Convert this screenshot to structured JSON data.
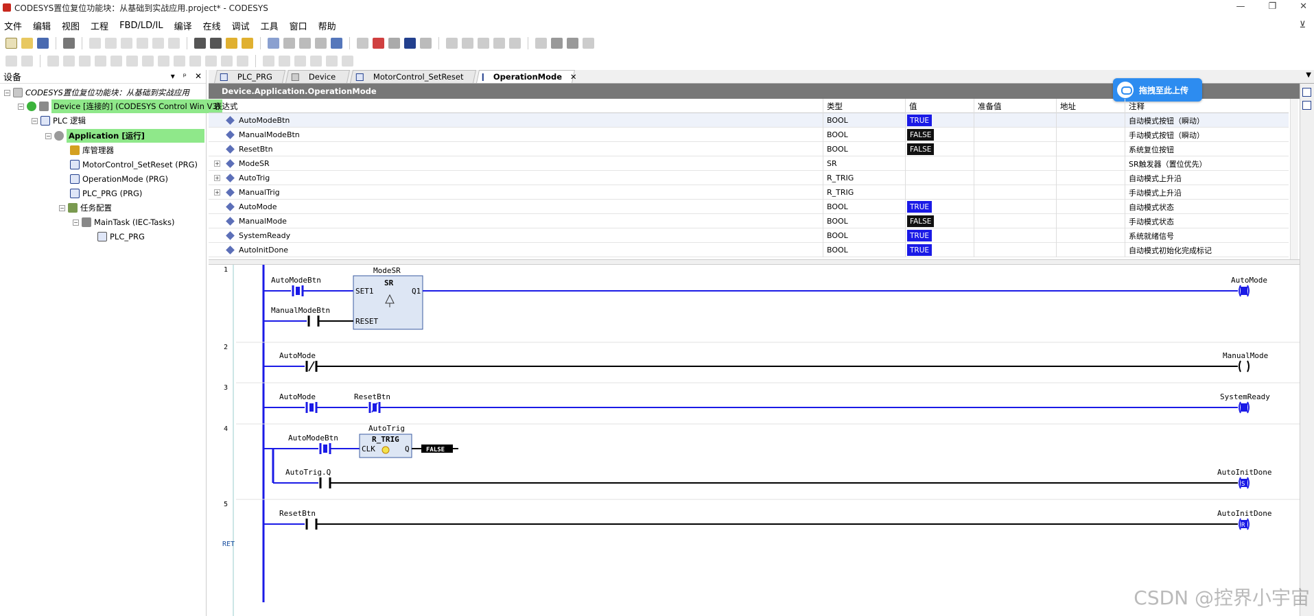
{
  "window": {
    "title": "CODESYS置位复位功能块：从基础到实战应用.project* - CODESYS",
    "controls": [
      "—",
      "❐",
      "✕"
    ]
  },
  "menu": [
    "文件",
    "编辑",
    "视图",
    "工程",
    "FBD/LD/IL",
    "编译",
    "在线",
    "调试",
    "工具",
    "窗口",
    "帮助"
  ],
  "device_panel": {
    "title": "设备",
    "header_buttons": [
      "▾",
      "ᵖ",
      "✕"
    ],
    "tree": [
      {
        "label": "CODESYS置位复位功能块：从基础到实战应用",
        "italic": true
      },
      {
        "label": "Device [连接的] (CODESYS Control Win V3)"
      },
      {
        "label": "PLC 逻辑"
      },
      {
        "label": "Application [运行]"
      },
      {
        "label": "库管理器"
      },
      {
        "label": "MotorControl_SetReset (PRG)"
      },
      {
        "label": "OperationMode (PRG)"
      },
      {
        "label": "PLC_PRG (PRG)"
      },
      {
        "label": "任务配置"
      },
      {
        "label": "MainTask (IEC-Tasks)"
      },
      {
        "label": "PLC_PRG"
      }
    ]
  },
  "tabs": [
    {
      "label": "PLC_PRG",
      "active": false
    },
    {
      "label": "Device",
      "active": false
    },
    {
      "label": "MotorControl_SetReset",
      "active": false
    },
    {
      "label": "OperationMode",
      "active": true
    }
  ],
  "tab_close": "✕",
  "path": "Device.Application.OperationMode",
  "upload_button": "拖拽至此上传",
  "watch_table": {
    "headers": [
      "表达式",
      "类型",
      "值",
      "准备值",
      "地址",
      "注释"
    ],
    "rows": [
      {
        "name": "AutoModeBtn",
        "type": "BOOL",
        "value": "TRUE",
        "comment": "自动模式按钮（瞬动）",
        "expandable": false
      },
      {
        "name": "ManualModeBtn",
        "type": "BOOL",
        "value": "FALSE",
        "comment": "手动模式按钮（瞬动）",
        "expandable": false
      },
      {
        "name": "ResetBtn",
        "type": "BOOL",
        "value": "FALSE",
        "comment": "系统复位按钮",
        "expandable": false
      },
      {
        "name": "ModeSR",
        "type": "SR",
        "value": "",
        "comment": "SR触发器（置位优先）",
        "expandable": true
      },
      {
        "name": "AutoTrig",
        "type": "R_TRIG",
        "value": "",
        "comment": "自动模式上升沿",
        "expandable": true
      },
      {
        "name": "ManualTrig",
        "type": "R_TRIG",
        "value": "",
        "comment": "手动模式上升沿",
        "expandable": true
      },
      {
        "name": "AutoMode",
        "type": "BOOL",
        "value": "TRUE",
        "comment": "自动模式状态",
        "expandable": false
      },
      {
        "name": "ManualMode",
        "type": "BOOL",
        "value": "FALSE",
        "comment": "手动模式状态",
        "expandable": false
      },
      {
        "name": "SystemReady",
        "type": "BOOL",
        "value": "TRUE",
        "comment": "系统就绪信号",
        "expandable": false
      },
      {
        "name": "AutoInitDone",
        "type": "BOOL",
        "value": "TRUE",
        "comment": "自动模式初始化完成标记",
        "expandable": false
      }
    ]
  },
  "ladder": {
    "networks": [
      {
        "number": "1",
        "fb_instance": "ModeSR",
        "fb_type": "SR",
        "in1": "SET1",
        "in2": "RESET",
        "out": "Q1",
        "contact1": "AutoModeBtn",
        "contact2": "ManualModeBtn",
        "coil": "AutoMode"
      },
      {
        "number": "2",
        "contact1": "AutoMode",
        "coil": "ManualMode"
      },
      {
        "number": "3",
        "contact1": "AutoMode",
        "contact2": "ResetBtn",
        "coil": "SystemReady"
      },
      {
        "number": "4",
        "fb_instance": "AutoTrig",
        "fb_type": "R_TRIG",
        "in1": "CLK",
        "out": "Q",
        "contact1": "AutoModeBtn",
        "contact2": "AutoTrig.Q",
        "coil": "AutoInitDone",
        "out_value": "FALSE",
        "coil_mark": "S"
      },
      {
        "number": "5",
        "contact1": "ResetBtn",
        "coil": "AutoInitDone",
        "coil_mark": "R"
      }
    ],
    "ret": "RET"
  },
  "watermark": "CSDN @控界小宇宙",
  "colors": {
    "energized": "#1a1ae6",
    "deenergized": "#000000",
    "fb_fill": "#dde6f4",
    "tree_highlight": "#8fe88a"
  }
}
